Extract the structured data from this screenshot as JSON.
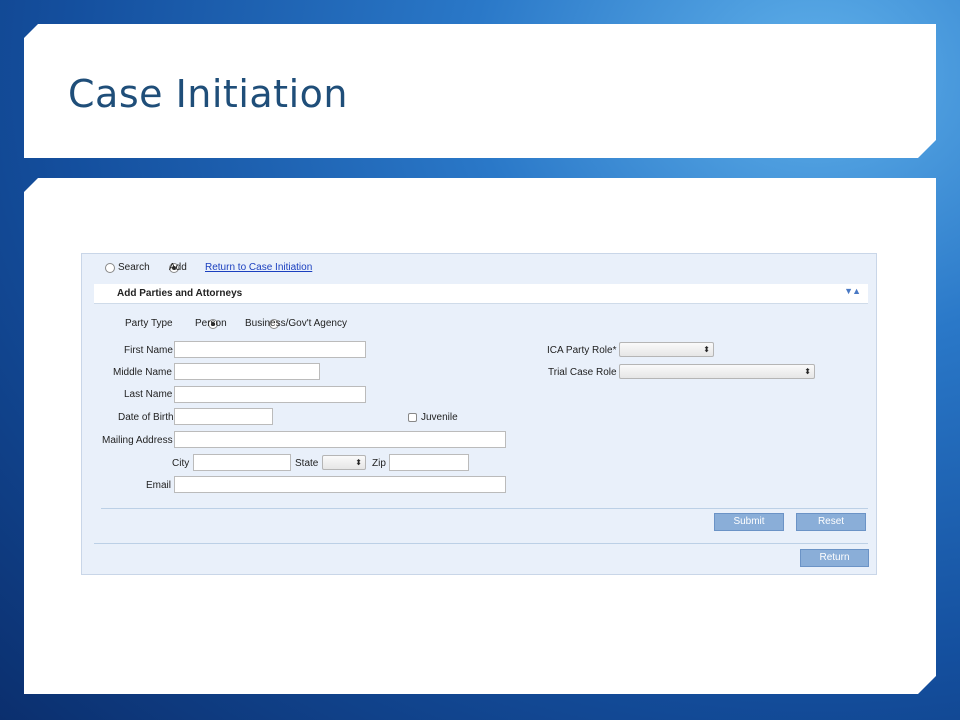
{
  "slide": {
    "title": "Case Initiation"
  },
  "mode": {
    "search_label": "Search",
    "add_label": "Add",
    "selected": "Add",
    "return_link": "Return to Case Initiation"
  },
  "section": {
    "title": "Add Parties and Attorneys"
  },
  "party_type": {
    "label": "Party Type",
    "options": [
      "Person",
      "Business/Gov't Agency"
    ],
    "selected": "Person"
  },
  "fields": {
    "first_name": {
      "label": "First Name",
      "value": ""
    },
    "middle_name": {
      "label": "Middle Name",
      "value": ""
    },
    "last_name": {
      "label": "Last Name",
      "value": ""
    },
    "dob": {
      "label": "Date of Birth",
      "value": ""
    },
    "juvenile": {
      "label": "Juvenile",
      "checked": false
    },
    "mailing_address": {
      "label": "Mailing Address",
      "value": ""
    },
    "city": {
      "label": "City",
      "value": ""
    },
    "state": {
      "label": "State",
      "value": ""
    },
    "zip": {
      "label": "Zip",
      "value": ""
    },
    "email": {
      "label": "Email",
      "value": ""
    },
    "ica_party_role": {
      "label": "ICA Party Role*",
      "value": ""
    },
    "trial_case_role": {
      "label": "Trial Case Role",
      "value": ""
    }
  },
  "buttons": {
    "submit": "Submit",
    "reset": "Reset",
    "return": "Return"
  },
  "colors": {
    "title": "#1f4e79",
    "button": "#8aaed8",
    "link": "#1a3fbf",
    "form_bg": "#e9f0fa"
  },
  "icons": {
    "collapse": "collapse-expand-arrows-icon",
    "select": "select-arrows-icon"
  }
}
